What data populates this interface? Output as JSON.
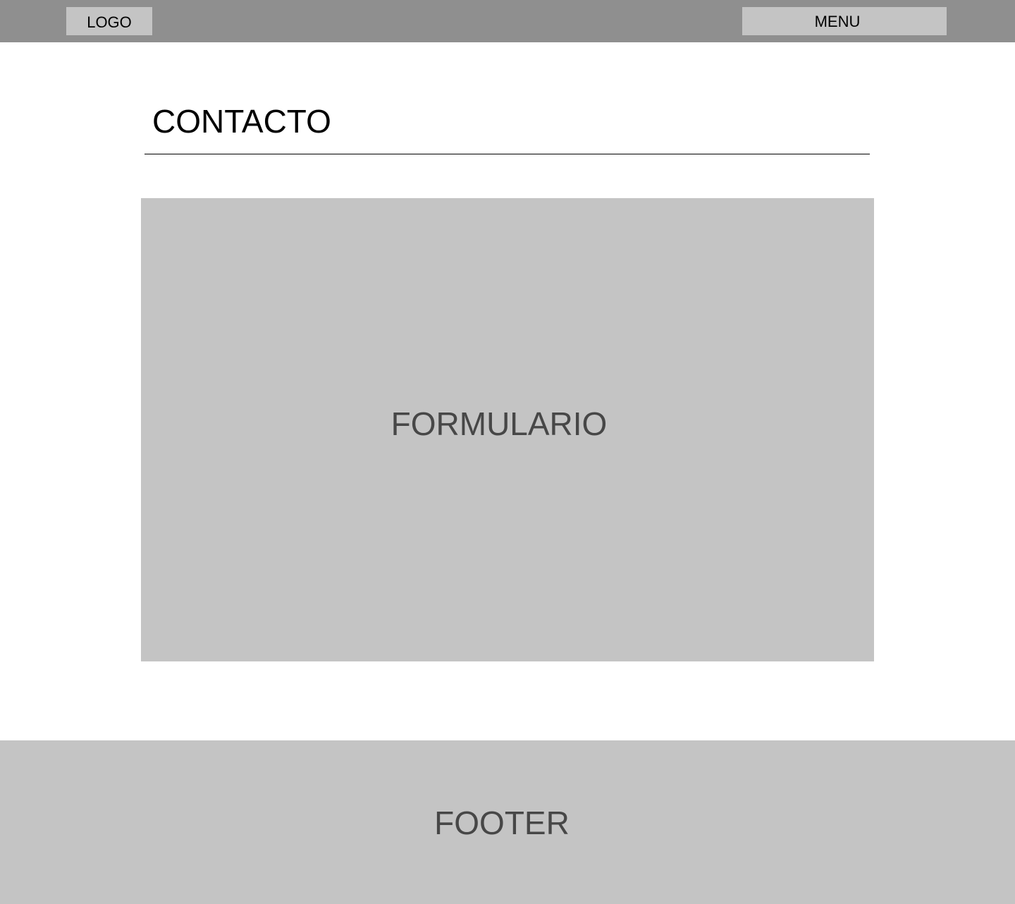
{
  "header": {
    "logo_label": "LOGO",
    "menu_label": "MENU"
  },
  "main": {
    "title": "CONTACTO",
    "form_placeholder_label": "FORMULARIO"
  },
  "footer": {
    "label": "FOOTER"
  },
  "colors": {
    "header_background": "#8f8f8f",
    "placeholder_background": "#c4c4c4",
    "placeholder_text": "#474747",
    "page_background": "#ffffff",
    "divider": "#000000"
  }
}
